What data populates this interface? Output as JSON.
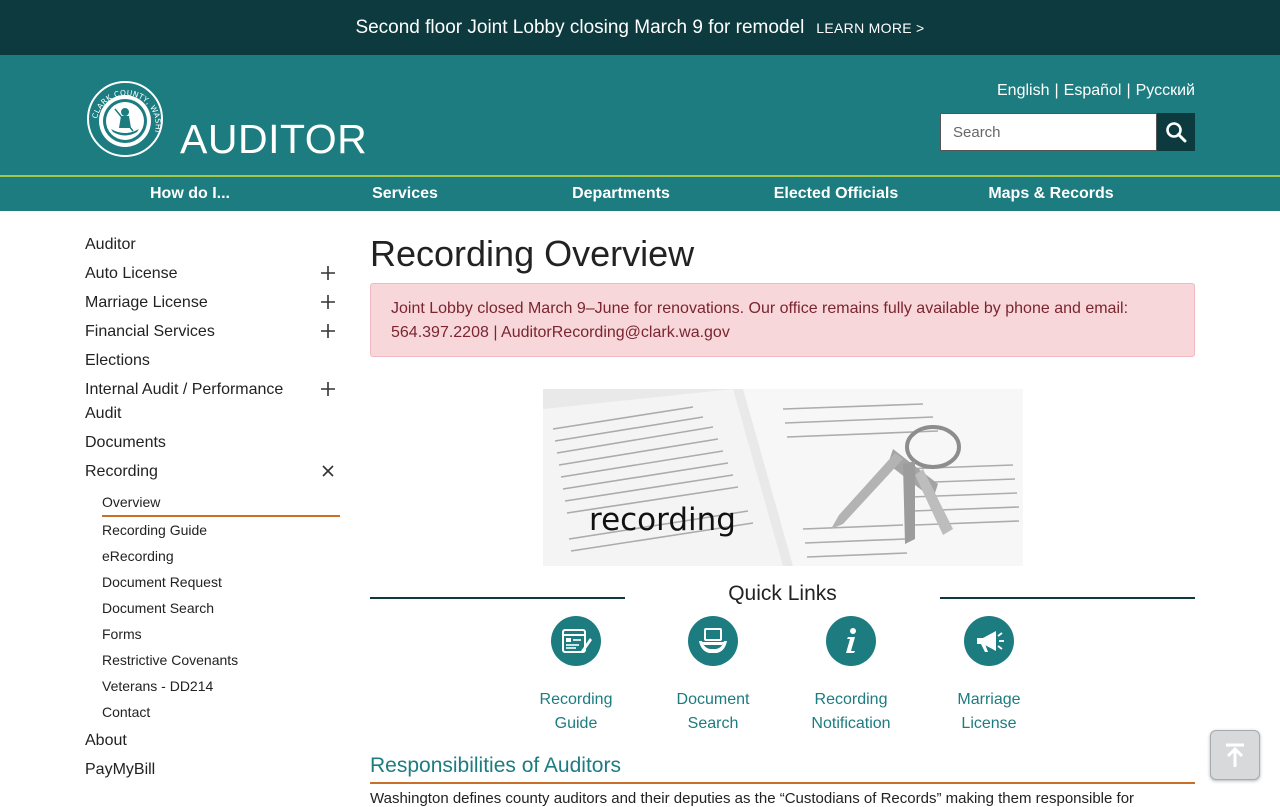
{
  "announcement": {
    "message": "Second floor Joint Lobby closing March 9 for remodel",
    "link": "LEARN MORE >"
  },
  "header": {
    "seal_text": "CLARK COUNTY, WASHINGTON",
    "site_title": "AUDITOR",
    "languages": [
      "English",
      "Español",
      "Русский"
    ],
    "separator": "|",
    "search_placeholder": "Search"
  },
  "nav": [
    "How do I...",
    "Services",
    "Departments",
    "Elected Officials",
    "Maps & Records"
  ],
  "sidebar": {
    "items": [
      {
        "label": "Auditor",
        "toggle": ""
      },
      {
        "label": "Auto License",
        "toggle": "plus"
      },
      {
        "label": "Marriage License",
        "toggle": "plus"
      },
      {
        "label": "Financial Services",
        "toggle": "plus"
      },
      {
        "label": "Elections",
        "toggle": ""
      },
      {
        "label": "Internal Audit / Performance Audit",
        "toggle": "plus"
      },
      {
        "label": "Documents",
        "toggle": ""
      },
      {
        "label": "Recording",
        "toggle": "close"
      }
    ],
    "recording_sub": [
      "Overview",
      "Recording Guide",
      "eRecording",
      "Document Request",
      "Document Search",
      "Forms",
      "Restrictive Covenants",
      "Veterans - DD214",
      "Contact"
    ],
    "bottom_items": [
      "About",
      "PayMyBill"
    ]
  },
  "main": {
    "title": "Recording Overview",
    "alert_line1": "Joint Lobby closed March 9–June for renovations. Our office remains fully available by phone and email:",
    "alert_line2": "564.397.2208 | AuditorRecording@clark.wa.gov",
    "hero_caption": "recording",
    "quick_links_title": "Quick Links",
    "quick_links": [
      {
        "line1": "Recording",
        "line2": "Guide",
        "icon": "document-form-icon"
      },
      {
        "line1": "Document",
        "line2": "Search",
        "icon": "laptop-hands-icon"
      },
      {
        "line1": "Recording",
        "line2": "Notification",
        "icon": "info-icon"
      },
      {
        "line1": "Marriage",
        "line2": "License",
        "icon": "megaphone-icon"
      }
    ],
    "responsibilities_heading": "Responsibilities of Auditors",
    "responsibilities_text": "Washington defines county auditors and their deputies as the “Custodians of Records” making them responsible for"
  },
  "colors": {
    "teal": "#1c7c80",
    "dark_teal": "#0c3a3f",
    "accent_orange": "#c8702a",
    "nav_green_rule": "#a6c84a",
    "alert_bg": "#f8d7da"
  }
}
